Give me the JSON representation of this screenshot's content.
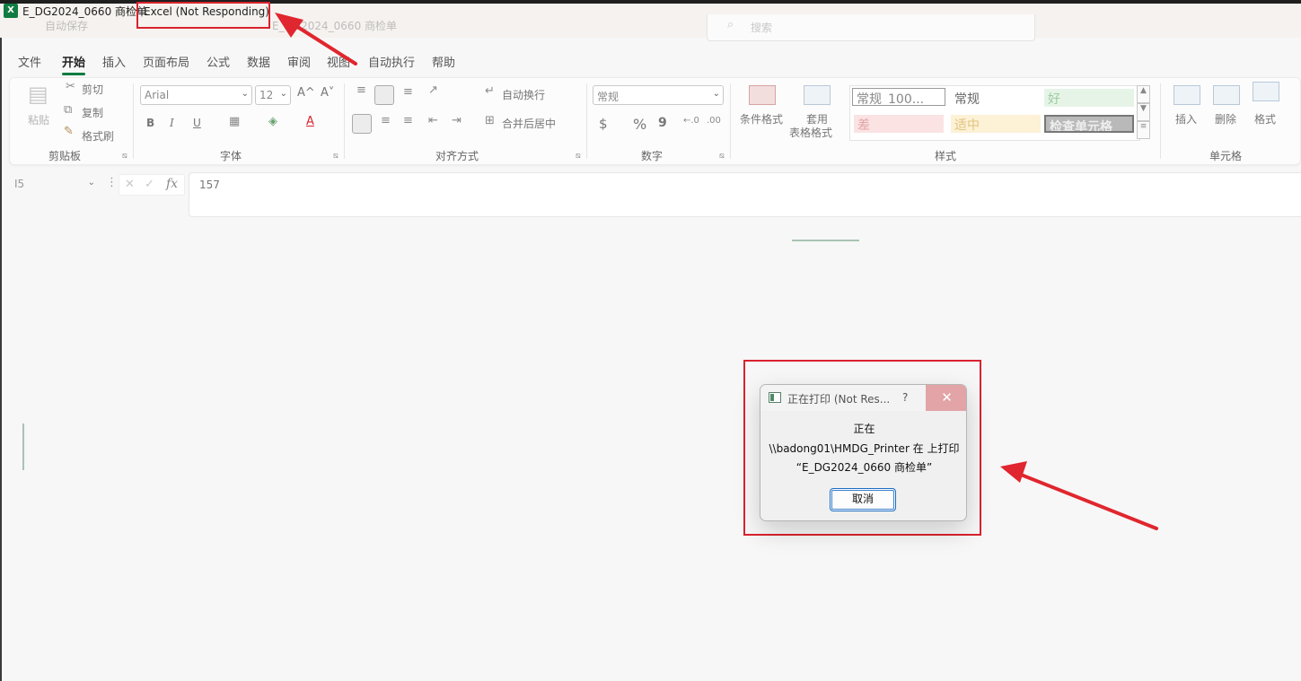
{
  "window": {
    "app_badge": "X",
    "title": "E_DG2024_0660 商检单",
    "title_sep": "-",
    "status": "Excel (Not Responding)",
    "ghost_autosave": "自动保存",
    "ghost_title": "E_DG2024_0660 商检单",
    "search_placeholder": "搜索"
  },
  "tabs": [
    "文件",
    "开始",
    "插入",
    "页面布局",
    "公式",
    "数据",
    "审阅",
    "视图",
    "自动执行",
    "帮助"
  ],
  "active_tab": "开始",
  "ribbon": {
    "clipboard": {
      "paste": "粘贴",
      "cut": "剪切",
      "copy": "复制",
      "format_painter": "格式刷",
      "label": "剪贴板"
    },
    "font": {
      "name": "Arial",
      "size": "12",
      "bold": "B",
      "italic": "I",
      "underline": "U",
      "grow": "A^",
      "shrink": "A˅",
      "label": "字体"
    },
    "alignment": {
      "wrap": "自动换行",
      "merge": "合并后居中",
      "label": "对齐方式"
    },
    "number": {
      "format": "常规",
      "currency": "$",
      "percent": "%",
      "comma": "9",
      "label": "数字"
    },
    "styles": {
      "conditional": "条件格式",
      "table_line1": "套用",
      "table_line2": "表格格式",
      "cells": [
        "常规_100...",
        "常规",
        "好",
        "差",
        "适中",
        "检查单元格"
      ],
      "label": "样式"
    },
    "cells": {
      "insert": "插入",
      "delete": "删除",
      "format": "格式",
      "label": "单元格"
    }
  },
  "formula_bar": {
    "name_box": "I5",
    "value": "157",
    "fx": "fx"
  },
  "dialog": {
    "title": "正在打印 (Not Res...",
    "help": "?",
    "close": "✕",
    "line1": "正在",
    "line2": "\\\\badong01\\HMDG_Printer 在  上打印",
    "line3": "“E_DG2024_0660 商检单”",
    "cancel": "取消"
  },
  "colors": {
    "excel_green": "#107c41",
    "annotation_red": "#d9232e"
  }
}
